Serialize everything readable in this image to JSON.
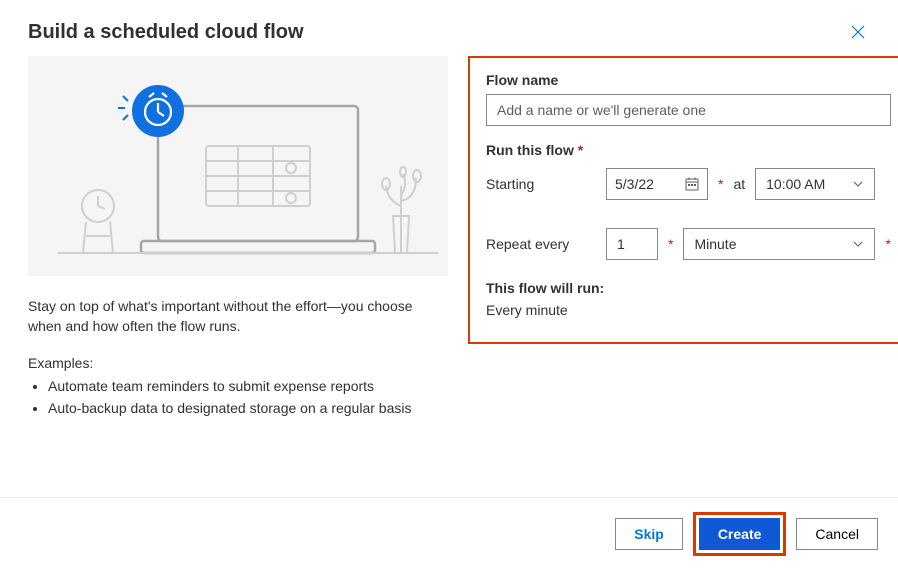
{
  "header": {
    "title": "Build a scheduled cloud flow"
  },
  "left": {
    "description": "Stay on top of what's important without the effort—you choose when and how often the flow runs.",
    "examples_label": "Examples:",
    "examples": [
      "Automate team reminders to submit expense reports",
      "Auto-backup data to designated storage on a regular basis"
    ]
  },
  "form": {
    "flow_name_label": "Flow name",
    "flow_name_placeholder": "Add a name or we'll generate one",
    "run_label": "Run this flow",
    "starting_label": "Starting",
    "starting_date": "5/3/22",
    "at_label": "at",
    "starting_time": "10:00 AM",
    "repeat_label": "Repeat every",
    "repeat_value": "1",
    "repeat_unit": "Minute",
    "summary_label": "This flow will run:",
    "summary_text": "Every minute"
  },
  "footer": {
    "skip": "Skip",
    "create": "Create",
    "cancel": "Cancel"
  }
}
